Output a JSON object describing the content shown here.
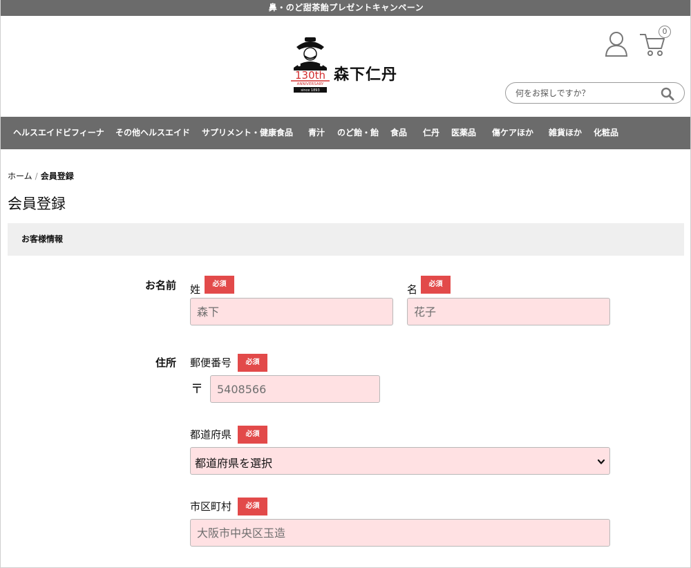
{
  "topbar": {
    "text": "鼻・のど甜茶飴プレゼントキャンペーン"
  },
  "logo": {
    "anniversary": "130th",
    "anniversary_sub": "ANNIVERSARY",
    "since": "since 1893",
    "brand": "森下仁丹"
  },
  "header": {
    "cart_count": "0",
    "search_placeholder": "何をお探しですか？"
  },
  "nav": {
    "items": [
      {
        "label": "ヘルスエイドビフィーナ"
      },
      {
        "label": "その他ヘルスエイド"
      },
      {
        "label": "サプリメント・健康食品"
      },
      {
        "label": "青汁"
      },
      {
        "label": "のど飴・飴"
      },
      {
        "label": "食品"
      },
      {
        "label": "仁丹"
      },
      {
        "label": "医薬品"
      },
      {
        "label": "傷ケアほか"
      },
      {
        "label": "雑貨ほか"
      },
      {
        "label": "化粧品"
      }
    ]
  },
  "breadcrumb": {
    "home": "ホーム",
    "separator": "/",
    "current": "会員登録"
  },
  "page": {
    "title": "会員登録",
    "section": "お客様情報"
  },
  "form": {
    "required": "必須",
    "name": {
      "label": "お名前",
      "last_label": "姓",
      "last_placeholder": "森下",
      "first_label": "名",
      "first_placeholder": "花子"
    },
    "address": {
      "label": "住所",
      "zip_label": "郵便番号",
      "zip_mark": "〒",
      "zip_placeholder": "5408566",
      "pref_label": "都道府県",
      "pref_selected": "都道府県を選択",
      "city_label": "市区町村",
      "city_placeholder": "大阪市中央区玉造"
    }
  }
}
